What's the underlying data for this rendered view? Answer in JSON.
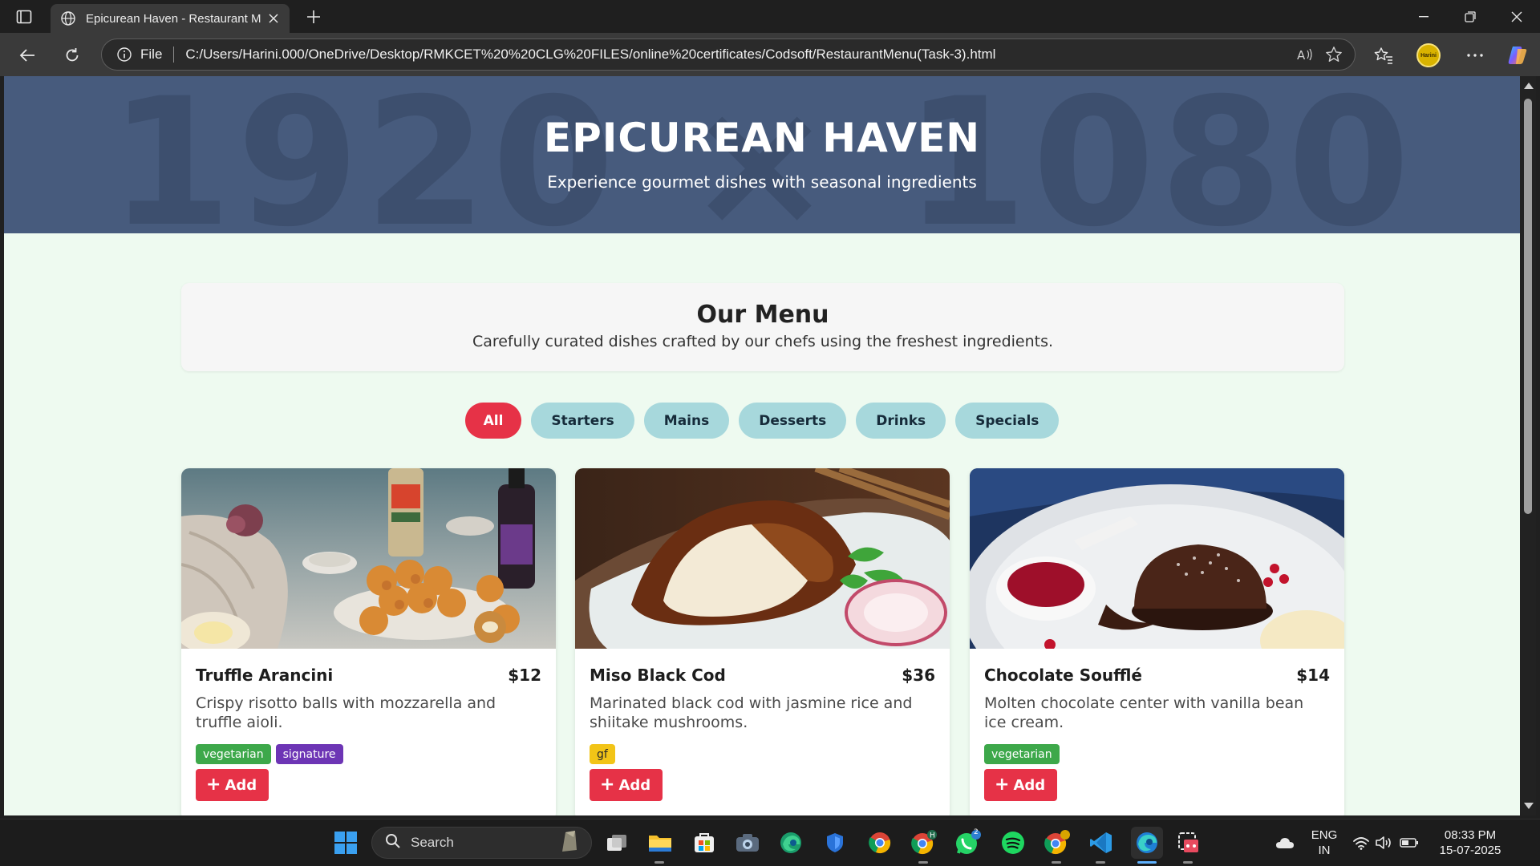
{
  "browser": {
    "tab_title": "Epicurean Haven - Restaurant Me",
    "address_scheme": "File",
    "url": "C:/Users/Harini.000/OneDrive/Desktop/RMKCET%20%20CLG%20FILES/online%20certificates/Codsoft/RestaurantMenu(Task-3).html",
    "profile_text": "Harini"
  },
  "hero": {
    "watermark": "1920 × 1080",
    "title": "EPICUREAN HAVEN",
    "subtitle": "Experience gourmet dishes with seasonal ingredients"
  },
  "menu_intro": {
    "title": "Our Menu",
    "subtitle": "Carefully curated dishes crafted by our chefs using the freshest ingredients."
  },
  "filters": [
    {
      "label": "All",
      "active": true
    },
    {
      "label": "Starters",
      "active": false
    },
    {
      "label": "Mains",
      "active": false
    },
    {
      "label": "Desserts",
      "active": false
    },
    {
      "label": "Drinks",
      "active": false
    },
    {
      "label": "Specials",
      "active": false
    }
  ],
  "dishes": [
    {
      "name": "Truffle Arancini",
      "price": "$12",
      "description": "Crispy risotto balls with mozzarella and truffle aioli.",
      "tags": [
        "vegetarian",
        "signature"
      ],
      "add_label": "Add",
      "photo": "fried-risotto-balls-photo"
    },
    {
      "name": "Miso Black Cod",
      "price": "$36",
      "description": "Marinated black cod with jasmine rice and shiitake mushrooms.",
      "tags": [
        "gf"
      ],
      "add_label": "Add",
      "photo": "glazed-fish-photo"
    },
    {
      "name": "Chocolate Soufflé",
      "price": "$14",
      "description": "Molten chocolate center with vanilla bean ice cream.",
      "tags": [
        "vegetarian"
      ],
      "add_label": "Add",
      "photo": "chocolate-lava-cake-photo"
    }
  ],
  "taskbar": {
    "search_label": "Search",
    "language_line1": "ENG",
    "language_line2": "IN",
    "time": "08:33 PM",
    "date": "15-07-2025",
    "whatsapp_badge": "2"
  },
  "colors": {
    "hero_bg": "#475b7d",
    "page_bg": "#eefaf0",
    "accent_red": "#e63247",
    "filter_bg": "#a7d8dc",
    "tag_vegetarian": "#3da84a",
    "tag_signature": "#6d35b5",
    "tag_gf": "#f2c417"
  }
}
